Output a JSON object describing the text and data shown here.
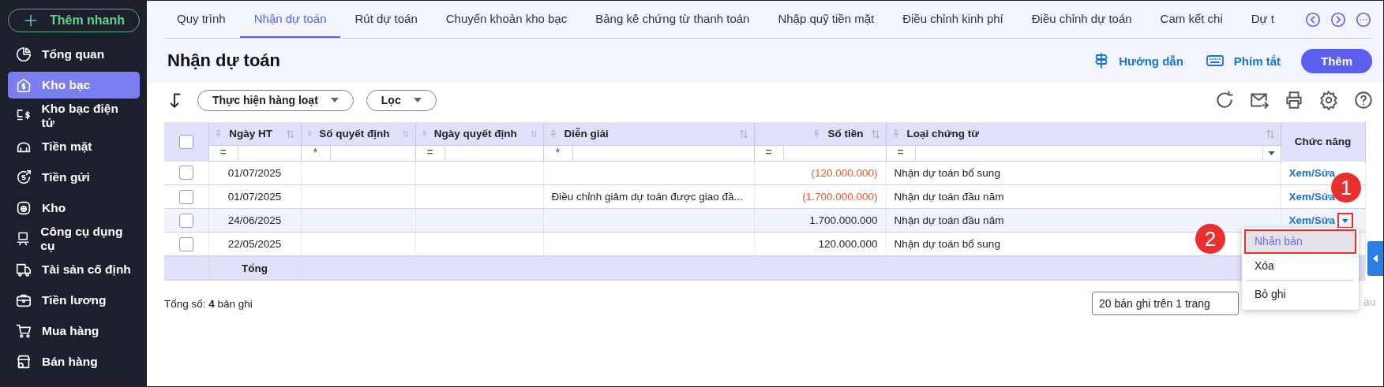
{
  "sidebar": {
    "quick_add": "Thêm nhanh",
    "items": [
      {
        "label": "Tổng quan",
        "selected": false
      },
      {
        "label": "Kho bạc",
        "selected": true
      },
      {
        "label": "Kho bạc điện tử",
        "selected": false
      },
      {
        "label": "Tiền mặt",
        "selected": false
      },
      {
        "label": "Tiền gửi",
        "selected": false
      },
      {
        "label": "Kho",
        "selected": false
      },
      {
        "label": "Công cụ dụng cụ",
        "selected": false
      },
      {
        "label": "Tài sản cố định",
        "selected": false
      },
      {
        "label": "Tiền lương",
        "selected": false
      },
      {
        "label": "Mua hàng",
        "selected": false
      },
      {
        "label": "Bán hàng",
        "selected": false
      }
    ]
  },
  "tabs": [
    {
      "label": "Quy trình",
      "selected": false
    },
    {
      "label": "Nhận dự toán",
      "selected": true
    },
    {
      "label": "Rút dự toán",
      "selected": false
    },
    {
      "label": "Chuyển khoản kho bạc",
      "selected": false
    },
    {
      "label": "Bảng kê chứng từ thanh toán",
      "selected": false
    },
    {
      "label": "Nhập quỹ tiền mặt",
      "selected": false
    },
    {
      "label": "Điều chỉnh kinh phí",
      "selected": false
    },
    {
      "label": "Điều chỉnh dự toán",
      "selected": false
    },
    {
      "label": "Cam kết chi",
      "selected": false
    },
    {
      "label": "Dự t",
      "selected": false
    }
  ],
  "page": {
    "title": "Nhận dự toán",
    "guide": "Hướng dẫn",
    "shortcuts": "Phím tắt",
    "add": "Thêm"
  },
  "toolbar": {
    "bulk_action": "Thực hiện hàng loạt",
    "filter": "Lọc"
  },
  "table": {
    "all_checked": false,
    "columns": [
      {
        "label": "Ngày HT",
        "filter_op": "="
      },
      {
        "label": "Số quyết định",
        "filter_op": "*"
      },
      {
        "label": "Ngày quyết định",
        "filter_op": "="
      },
      {
        "label": "Diễn giải",
        "filter_op": "*"
      },
      {
        "label": "Số tiền",
        "filter_op": "="
      },
      {
        "label": "Loại chứng từ",
        "filter_op": "="
      },
      {
        "label": "Chức năng"
      }
    ],
    "rows": [
      {
        "checked": false,
        "highlighted": false,
        "posting_date": "01/07/2025",
        "amount": "(120.000.000)",
        "negative": true,
        "voucher_type": "Nhận dự toán bổ sung",
        "action": "Xem/Sửa"
      },
      {
        "checked": false,
        "highlighted": false,
        "posting_date": "01/07/2025",
        "description": "Điều chỉnh giảm dự toán được giao đầ...",
        "amount": "(1.700.000.000)",
        "negative": true,
        "voucher_type": "Nhận dự toán đầu năm",
        "action": "Xem/Sửa"
      },
      {
        "checked": false,
        "highlighted": true,
        "posting_date": "24/06/2025",
        "amount": "1.700.000.000",
        "negative": false,
        "voucher_type": "Nhận dự toán đầu năm",
        "action": "Xem/Sửa"
      },
      {
        "checked": false,
        "highlighted": false,
        "posting_date": "22/05/2025",
        "amount": "120.000.000",
        "negative": false,
        "voucher_type": "Nhận dự toán bổ sung"
      }
    ],
    "total_label": "Tổng"
  },
  "footer": {
    "record_count": "Tổng số: **4** bản ghi",
    "page_size": "20 bản ghi trên 1 trang",
    "next_partial": "au"
  },
  "row_menu": {
    "items": [
      {
        "label": "Nhân bản",
        "selected": true
      },
      {
        "label": "Xóa",
        "selected": false
      },
      {
        "label": "Bỏ ghi",
        "selected": false
      }
    ]
  },
  "annotations": [
    {
      "label": "1",
      "color": "#e8312f"
    },
    {
      "label": "2",
      "color": "#e8312f"
    }
  ]
}
